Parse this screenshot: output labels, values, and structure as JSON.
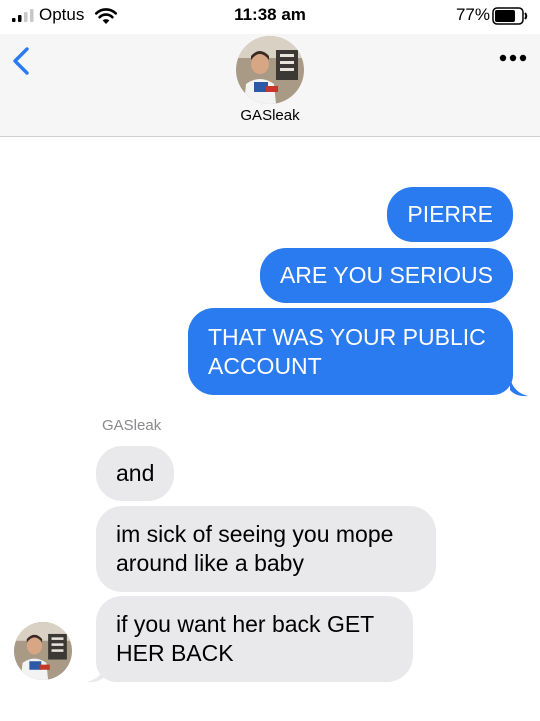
{
  "status_bar": {
    "carrier": "Optus",
    "time": "11:38 am",
    "battery_percent": "77%",
    "battery_level": 0.77,
    "signal_bars": 2,
    "icons": [
      "signal-bars-icon",
      "wifi-icon",
      "battery-icon"
    ]
  },
  "header": {
    "contact_name": "GASleak",
    "icons": [
      "back-chevron-icon",
      "more-options-icon"
    ]
  },
  "conversation": {
    "sent": [
      {
        "text": "PIERRE"
      },
      {
        "text": "ARE YOU SERIOUS"
      },
      {
        "text": "THAT WAS YOUR PUBLIC ACCOUNT"
      }
    ],
    "received_sender": "GASleak",
    "received": [
      {
        "text": "and"
      },
      {
        "text": "im sick of seeing you mope around like a baby"
      },
      {
        "text": "if you want her back GET HER BACK"
      }
    ]
  },
  "colors": {
    "sent_bubble": "#2b7bf0",
    "received_bubble": "#e9e9eb",
    "accent": "#2b7bf0",
    "header_background": "#f6f6f7"
  }
}
